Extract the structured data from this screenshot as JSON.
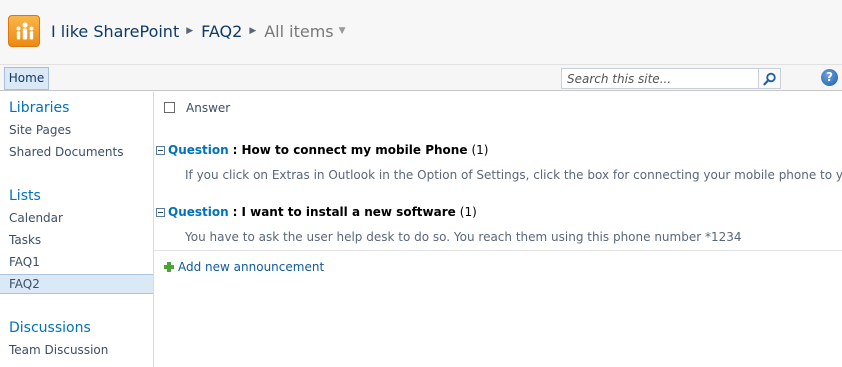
{
  "header": {
    "site_title": "I like SharePoint",
    "list_name": "FAQ2",
    "view_name": "All items",
    "logo_icon": "sharepoint-people-logo-icon"
  },
  "topnav": {
    "home_tab": "Home",
    "search_placeholder": "Search this site...",
    "help_label": "?"
  },
  "leftnav": {
    "sections": [
      {
        "title": "Libraries",
        "items": [
          "Site Pages",
          "Shared Documents"
        ]
      },
      {
        "title": "Lists",
        "items": [
          "Calendar",
          "Tasks",
          "FAQ1",
          "FAQ2"
        ]
      },
      {
        "title": "Discussions",
        "items": [
          "Team Discussion"
        ]
      }
    ],
    "selected_item": "FAQ2"
  },
  "main": {
    "column_header": "Answer",
    "groups": [
      {
        "field": "Question",
        "value": "How to connect my mobile Phone",
        "count": "(1)",
        "answer": "If you click on Extras in Outlook in the Option of Settings, click the box for connecting your mobile phone to yes."
      },
      {
        "field": "Question",
        "value": "I want to install a new software",
        "count": "(1)",
        "answer": "You have to ask the user help desk to do so. You reach them using this phone number *1234"
      }
    ],
    "add_link": "Add new announcement"
  },
  "colors": {
    "link_blue": "#0072bc",
    "selected_bg": "#dbe8f5",
    "logo_orange": "#ee8a12"
  }
}
